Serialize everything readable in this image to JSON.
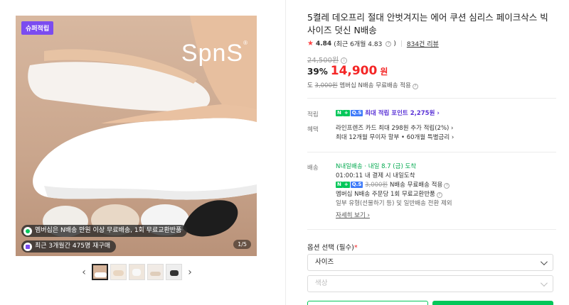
{
  "gallery": {
    "badge": "슈퍼적립",
    "brand": "SpnS",
    "brand_mark": "®",
    "pill_membership": "멤버십은 N배송 만원 이상 무료배송, 1회 무료교환반품",
    "pill_reorder": "최근 3개월간 475명 재구매",
    "page_indicator": "1/5",
    "prev_arrow": "‹",
    "next_arrow": "›",
    "thumb_count": 5
  },
  "product": {
    "title": "5켤레 데오프리 절대 안벗겨지는 에어 쿠션 심리스 페이크삭스 빅사이즈 덧신 N배송",
    "rating_star": "★",
    "rating_score": "4.84",
    "rating_recent": "(최근 6개월 4.83",
    "rating_recent_close": ")",
    "reviews": "834건 리뷰",
    "original_price": "24,500원",
    "discount": "39%",
    "price": "14,900",
    "currency": "원",
    "shipping_prefix": "도",
    "shipping_old": "3,000원",
    "shipping_text": "멤버십 N배송 무료배송 적용"
  },
  "benefits": {
    "points_label": "적립",
    "points_npay": "N",
    "points_npay2": "+",
    "points_badge": "Q.S",
    "points_text": "최대 적립 포인트 2,275원 ›",
    "discount_label": "혜택",
    "discount_line1": "라인프렌즈 카드 최대 298원 추가 적립(2%) ›",
    "discount_line2": "최대 12개월 무이자 할부 • 60개월 특별금리 ›"
  },
  "delivery": {
    "label": "배송",
    "line1_tag": "N내일배송",
    "line1_text": "· 내일 8.7 (금) 도착",
    "line2": "01:00:11  내 결제 시 내일도착",
    "line3_old": "3,000원",
    "line3_text": "N배송 무료배송 적용",
    "line4": "멤버십 N배송 주문당 1회 무료교환반품",
    "line5": "일부 유형(선물하기 등) 및 일반배송 전환 제외",
    "more": "자세히 보기 ›"
  },
  "options": {
    "label": "옵션 선택 (필수)",
    "required_mark": "*",
    "size_value": "사이즈",
    "color_placeholder": "색상"
  },
  "colors": {
    "accent_red": "#f42626",
    "npay_green": "#03c75a",
    "super_purple": "#7b4cf0"
  }
}
